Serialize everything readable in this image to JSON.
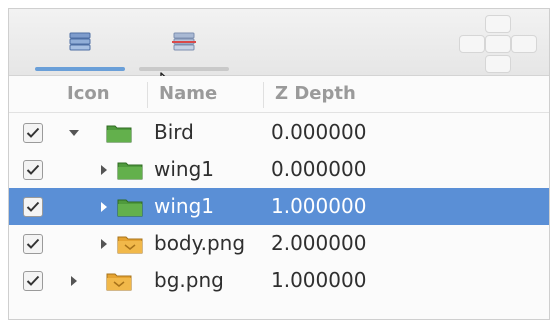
{
  "header": {
    "icon": "Icon",
    "name": "Name",
    "depth": "Z Depth"
  },
  "tabs": [
    {
      "icon": "layers-icon",
      "active": true
    },
    {
      "icon": "disabled-layers-icon",
      "active": false
    }
  ],
  "rows": [
    {
      "name": "Bird",
      "depth": "0.000000",
      "checked": true,
      "expanded": true,
      "icon": "folder-icon",
      "icon_color": "#4f9a3d",
      "selected": false
    },
    {
      "name": "wing1",
      "depth": "0.000000",
      "checked": true,
      "expanded": false,
      "icon": "folder-icon",
      "icon_color": "#4f9a3d",
      "selected": false
    },
    {
      "name": "wing1",
      "depth": "1.000000",
      "checked": true,
      "expanded": false,
      "icon": "folder-icon",
      "icon_color": "#4f9a3d",
      "selected": true
    },
    {
      "name": "body.png",
      "depth": "2.000000",
      "checked": true,
      "expanded": false,
      "icon": "image-layer-icon",
      "icon_color": "#e5a331",
      "selected": false
    },
    {
      "name": "bg.png",
      "depth": "1.000000",
      "checked": true,
      "expanded": false,
      "icon": "image-layer-icon",
      "icon_color": "#e5a331",
      "selected": false
    }
  ],
  "colors": {
    "selection": "#5a8fd6",
    "group_folder": "#4f9a3d",
    "image_layer": "#e5a331"
  }
}
